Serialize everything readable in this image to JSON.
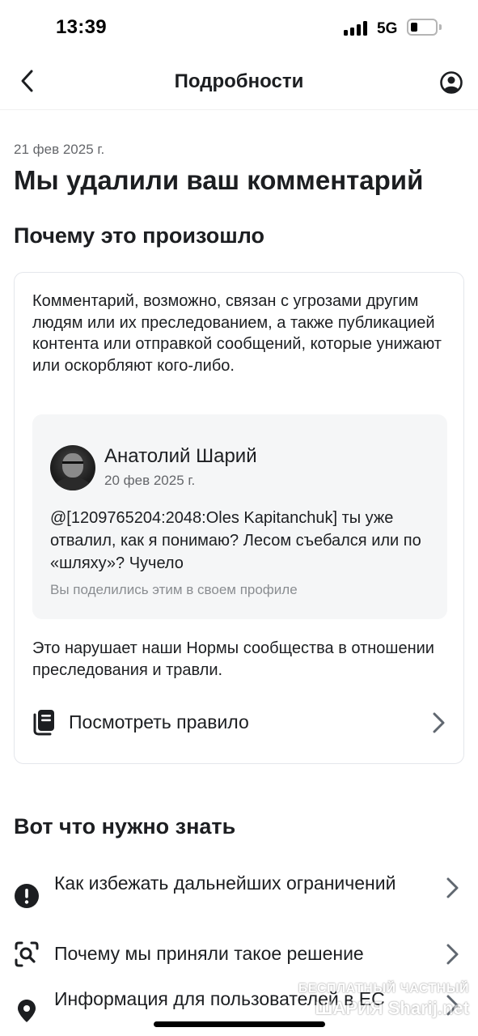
{
  "status_bar": {
    "time": "13:39",
    "network": "5G",
    "battery_level": 0.3
  },
  "nav": {
    "title": "Подробности",
    "back_icon": "chevron-left-icon",
    "profile_icon": "user-circle-icon"
  },
  "notice": {
    "date": "21 фев 2025 г.",
    "title": "Мы удалили ваш комментарий"
  },
  "why_section": {
    "title": "Почему это произошло",
    "explanation": "Комментарий, возможно, связан с угрозами другим людям или их преследованием, а также публикацией контента или отправкой сообщений, которые унижают или оскорбляют кого-либо.",
    "comment": {
      "author": "Анатолий Шарий",
      "date": "20 фев 2025 г.",
      "text": "@[1209765204:2048:Oles Kapitanchuk] ты уже отвалил, как я понимаю? Лесом съебался или по «шляху»? Чучело",
      "shared_note": "Вы поделились этим в своем профиле"
    },
    "violation_text": "Это нарушает наши Нормы сообщества в отношении преследования и травли.",
    "rule_link": {
      "label": "Посмотреть правило",
      "icon": "document-stack-icon"
    }
  },
  "know_section": {
    "title": "Вот что нужно знать",
    "items": [
      {
        "label": "Как избежать дальнейших ограничений",
        "icon": "exclamation-circle-icon"
      },
      {
        "label": "Почему мы приняли такое решение",
        "icon": "search-scan-icon"
      },
      {
        "label": "Информация для пользователей в ЕС",
        "icon": "location-pin-icon"
      }
    ]
  },
  "watermark": {
    "line1": "БЕСПЛАТНЫЙ ЧАСТНЫЙ",
    "line2": "ШАРИЯ Sharij.net"
  }
}
